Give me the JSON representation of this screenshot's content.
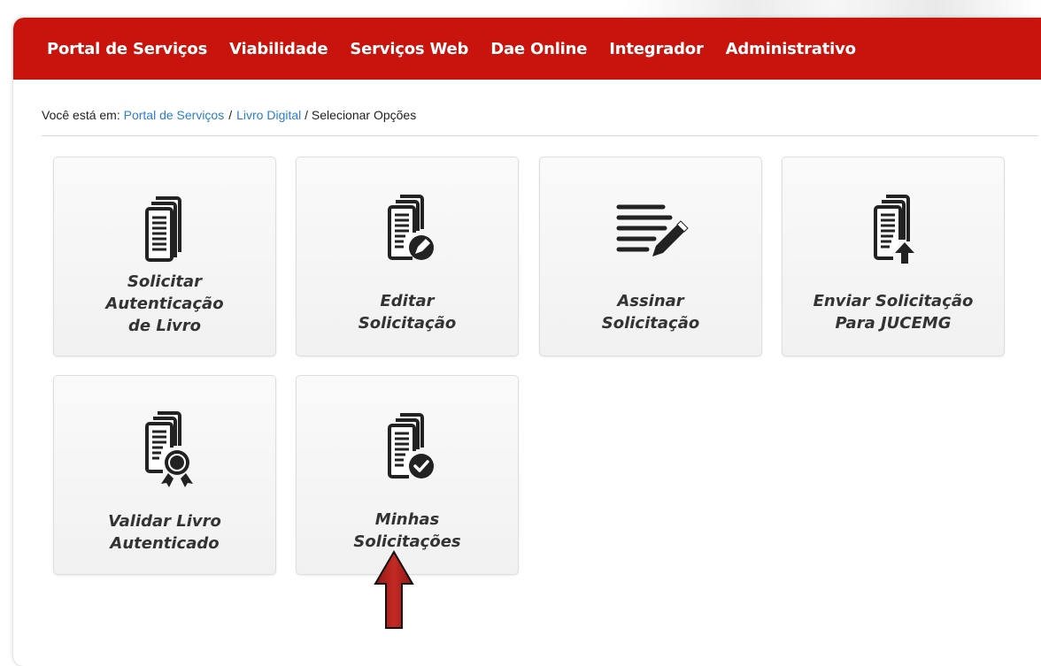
{
  "nav": {
    "items": [
      {
        "label": "Portal de Serviços"
      },
      {
        "label": "Viabilidade"
      },
      {
        "label": "Serviços Web"
      },
      {
        "label": "Dae Online"
      },
      {
        "label": "Integrador"
      },
      {
        "label": "Administrativo"
      }
    ]
  },
  "breadcrumb": {
    "prefix": "Você está em:",
    "link1": "Portal de Serviços",
    "sep": "/",
    "link2": "Livro Digital",
    "current": "/ Selecionar Opções"
  },
  "tiles": [
    {
      "line1": "Solicitar",
      "line2": "Autenticação",
      "line3": "de Livro",
      "icon": "document-stack-icon"
    },
    {
      "line1": "Editar",
      "line2": "Solicitação",
      "icon": "document-edit-icon"
    },
    {
      "line1": "Assinar",
      "line2": "Solicitação",
      "icon": "sign-lines-pen-icon"
    },
    {
      "line1": "Enviar Solicitação",
      "line2": "Para JUCEMG",
      "icon": "document-upload-icon"
    },
    {
      "line1": "Validar Livro",
      "line2": "Autenticado",
      "icon": "document-seal-icon"
    },
    {
      "line1": "Minhas",
      "line2": "Solicitações",
      "icon": "document-check-icon"
    }
  ],
  "colors": {
    "navbar": "#c8140c",
    "link": "#2a7fd0",
    "arrow": "#b3221d"
  }
}
